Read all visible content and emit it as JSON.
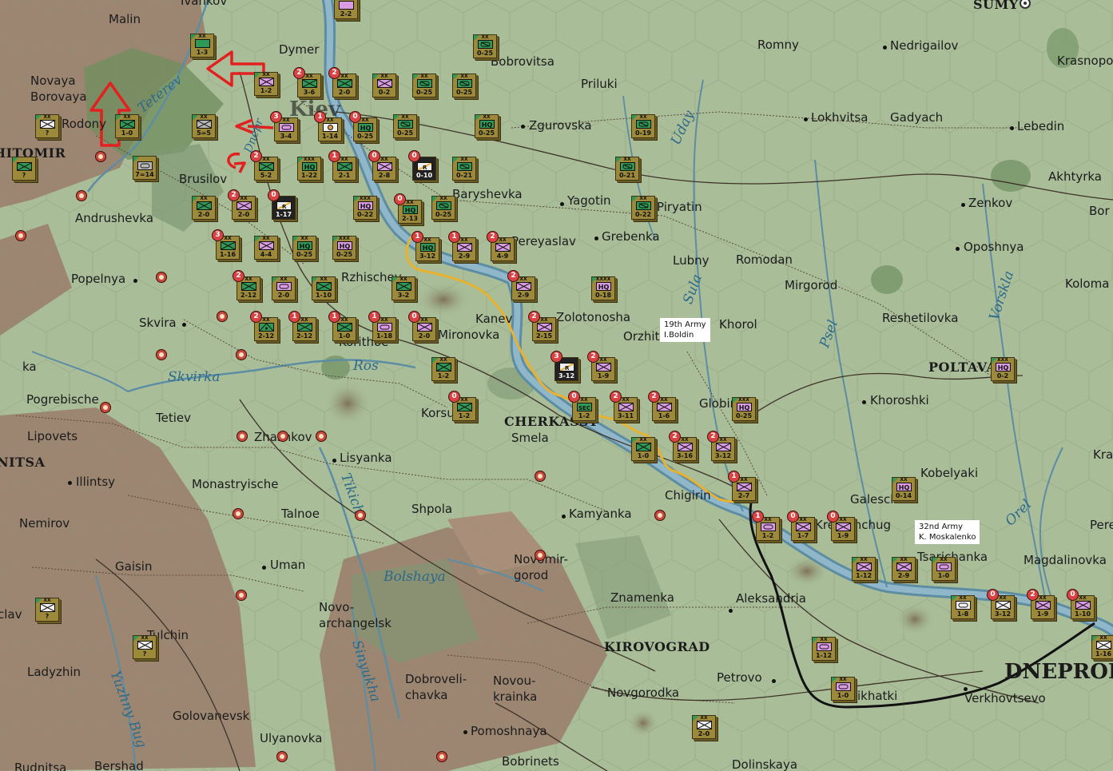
{
  "map": {
    "towns": [
      {
        "id": "ivankov",
        "text": "Ivankov"
      },
      {
        "id": "malin",
        "text": "Malin"
      },
      {
        "id": "dymer",
        "text": "Dymer"
      },
      {
        "id": "bobrovitsa",
        "text": "Bobrovitsa"
      },
      {
        "id": "romny",
        "text": "Romny"
      },
      {
        "id": "nedrigailov",
        "text": "Nedrigailov"
      },
      {
        "id": "sumy",
        "text": "SUMY"
      },
      {
        "id": "krasnopol",
        "text": "Krasnopol"
      },
      {
        "id": "novaya_borovaya",
        "text": "Novaya\nBorovaya"
      },
      {
        "id": "rodony",
        "text": "Rodony"
      },
      {
        "id": "zhitomir",
        "text": "HITOMIR"
      },
      {
        "id": "kiev",
        "text": "Kiev"
      },
      {
        "id": "priluki",
        "text": "Priluki"
      },
      {
        "id": "zgurovska",
        "text": "Zgurovska"
      },
      {
        "id": "lokhvitsa",
        "text": "Lokhvitsa"
      },
      {
        "id": "gadyach",
        "text": "Gadyach"
      },
      {
        "id": "lebedin",
        "text": "Lebedin"
      },
      {
        "id": "akhtyrka",
        "text": "Akhtyrka"
      },
      {
        "id": "brusilov",
        "text": "Brusilov"
      },
      {
        "id": "baryshevka",
        "text": "Baryshevka"
      },
      {
        "id": "yagotin",
        "text": "Yagotin"
      },
      {
        "id": "piryatin",
        "text": "Piryatin"
      },
      {
        "id": "zenkov",
        "text": "Zenkov"
      },
      {
        "id": "bor",
        "text": "Bor"
      },
      {
        "id": "andrushevka",
        "text": "Andrushevka"
      },
      {
        "id": "pereyaslav",
        "text": "Pereyaslav"
      },
      {
        "id": "grebenka",
        "text": "Grebenka"
      },
      {
        "id": "lubny",
        "text": "Lubny"
      },
      {
        "id": "romodan",
        "text": "Romodan"
      },
      {
        "id": "oposhnya",
        "text": "Oposhnya"
      },
      {
        "id": "popelnya",
        "text": "Popelnya"
      },
      {
        "id": "rzhischev",
        "text": "Rzhischev"
      },
      {
        "id": "mirgorod",
        "text": "Mirgorod"
      },
      {
        "id": "koloma",
        "text": "Koloma"
      },
      {
        "id": "skvira",
        "text": "Skvira"
      },
      {
        "id": "kanev",
        "text": "Kanev"
      },
      {
        "id": "zolotonosha",
        "text": "Zolotonosha"
      },
      {
        "id": "horol",
        "text": "Khorol"
      },
      {
        "id": "orzhitsa",
        "text": "Orzhitsa"
      },
      {
        "id": "reshetilovka",
        "text": "Reshetilovka"
      },
      {
        "id": "mironovka",
        "text": "Mironovka"
      },
      {
        "id": "korithoe",
        "text": "Korithoe"
      },
      {
        "id": "poltava",
        "text": "POLTAVA"
      },
      {
        "id": "ka",
        "text": "ka"
      },
      {
        "id": "pogrebische",
        "text": "Pogrebische"
      },
      {
        "id": "korsun",
        "text": "Korsun"
      },
      {
        "id": "globino",
        "text": "Globino"
      },
      {
        "id": "khoroshki",
        "text": "Khoroshki"
      },
      {
        "id": "tetiev",
        "text": "Tetiev"
      },
      {
        "id": "cherkassy",
        "text": "CHERKASSY"
      },
      {
        "id": "smela",
        "text": "Smela"
      },
      {
        "id": "zhashkov",
        "text": "Zhashkov"
      },
      {
        "id": "lisyanka",
        "text": "Lisyanka"
      },
      {
        "id": "vinnitsa",
        "text": "NITSA"
      },
      {
        "id": "lets",
        "text": "Lipovets"
      },
      {
        "id": "kobelyaki",
        "text": "Kobelyaki"
      },
      {
        "id": "illintsy",
        "text": "Illintsy"
      },
      {
        "id": "monastryische",
        "text": "Monastryische"
      },
      {
        "id": "chigirin",
        "text": "Chigirin"
      },
      {
        "id": "galeschina",
        "text": "Galeschina"
      },
      {
        "id": "kra",
        "text": "Kra"
      },
      {
        "id": "nemirov",
        "text": "Nemirov"
      },
      {
        "id": "talnoe",
        "text": "Talnoe"
      },
      {
        "id": "shpola",
        "text": "Shpola"
      },
      {
        "id": "kamyanka",
        "text": "Kamyanka"
      },
      {
        "id": "kremenchug",
        "text": "Kremenchug"
      },
      {
        "id": "pere",
        "text": "Pere"
      },
      {
        "id": "gaisin",
        "text": "Gaisin"
      },
      {
        "id": "uman",
        "text": "Uman"
      },
      {
        "id": "novomirgorod",
        "text": "Novomir-\ngorod"
      },
      {
        "id": "magdalinovka",
        "text": "Magdalinovka"
      },
      {
        "id": "tsarichanka",
        "text": "Tsarichanka"
      },
      {
        "id": "bratslav",
        "text": "clav"
      },
      {
        "id": "novoarkhangelsk",
        "text": "Novo-\narchangelsk"
      },
      {
        "id": "znamenka",
        "text": "Znamenka"
      },
      {
        "id": "aleksandria",
        "text": "Aleksandria"
      },
      {
        "id": "kirovograd",
        "text": "KIROVOGRAD"
      },
      {
        "id": "tulchin",
        "text": "Tulchin"
      },
      {
        "id": "ladyzhin",
        "text": "Ladyzhin"
      },
      {
        "id": "dobrovelichkovka",
        "text": "Dobroveli-\nchavka"
      },
      {
        "id": "novoukrainka",
        "text": "Novou-\nkrainka"
      },
      {
        "id": "novgorodka",
        "text": "Novgorodka"
      },
      {
        "id": "petrovo",
        "text": "Petrovo"
      },
      {
        "id": "dnepropetrovsk",
        "text": "DNEPROP"
      },
      {
        "id": "verkhovtsevo",
        "text": "Verkhovtsevo"
      },
      {
        "id": "pyatikhatki",
        "text": "Pyatikhatki"
      },
      {
        "id": "golovanevsk",
        "text": "Golovanevsk"
      },
      {
        "id": "ulyanovka",
        "text": "Ulyanovka"
      },
      {
        "id": "pomoshnaya",
        "text": "Pomoshnaya"
      },
      {
        "id": "bobrinets",
        "text": "Bobrinets"
      },
      {
        "id": "dolinskaya",
        "text": "Dolinskaya"
      },
      {
        "id": "rudnitsa",
        "text": "Rudnitsa"
      },
      {
        "id": "bershad",
        "text": "Bershad"
      }
    ],
    "rivers": [
      {
        "id": "teterev",
        "text": "Teterev"
      },
      {
        "id": "dnepr",
        "text": "Dnepr"
      },
      {
        "id": "uday",
        "text": "Uday"
      },
      {
        "id": "sula",
        "text": "Sula"
      },
      {
        "id": "psel",
        "text": "Psel"
      },
      {
        "id": "vorskla",
        "text": "Vorskla"
      },
      {
        "id": "ros",
        "text": "Ros"
      },
      {
        "id": "skvirka",
        "text": "Skvirka"
      },
      {
        "id": "tikich",
        "text": "Tikich"
      },
      {
        "id": "orel",
        "text": "Orel"
      },
      {
        "id": "bolshaya",
        "text": "Bolshaya"
      },
      {
        "id": "sinyukha",
        "text": "Sinyukha"
      },
      {
        "id": "yuzhny_bug",
        "text": "Yuzhny Bug"
      }
    ],
    "annotations": [
      {
        "id": "army19",
        "line1": "19th Army",
        "line2": "I.Boldin"
      },
      {
        "id": "army32",
        "line1": "32nd Army",
        "line2": "K. Moskalenko"
      }
    ],
    "units": [
      {
        "id": "u01",
        "size": "XX",
        "val": "1-3",
        "color": "g"
      },
      {
        "id": "u02",
        "size": "XX",
        "val": "2-2",
        "color": "p"
      },
      {
        "id": "u03",
        "size": "XX",
        "val": "0-25",
        "color": "g",
        "kind": "recon"
      },
      {
        "id": "u04",
        "size": "XX",
        "val": "1-2",
        "color": "p",
        "badge": "",
        "kind": "inf"
      },
      {
        "id": "u05",
        "size": "XX",
        "val": "3-6",
        "color": "g",
        "badge": "2",
        "kind": "inf"
      },
      {
        "id": "u06",
        "size": "XX",
        "val": "2-0",
        "color": "g",
        "badge": "2",
        "kind": "inf"
      },
      {
        "id": "u07",
        "size": "XX",
        "val": "0-2",
        "color": "p",
        "kind": "inf"
      },
      {
        "id": "u08",
        "size": "XX",
        "val": "0-25",
        "color": "g",
        "kind": "recon"
      },
      {
        "id": "u09",
        "size": "XX",
        "val": "0-25",
        "color": "g",
        "kind": "recon"
      },
      {
        "id": "u10",
        "size": "XX",
        "val": "1-0",
        "color": "g",
        "kind": "inf"
      },
      {
        "id": "u11",
        "size": "XX",
        "val": "5=5",
        "color": "gr",
        "kind": "inf"
      },
      {
        "id": "u12",
        "size": "XX",
        "val": "?",
        "color": "w",
        "kind": "inf"
      },
      {
        "id": "u13",
        "size": "",
        "val": "?",
        "color": "g",
        "kind": "inf"
      },
      {
        "id": "u14",
        "size": "XX",
        "val": "3-4",
        "color": "p",
        "badge": "3",
        "kind": "arm"
      },
      {
        "id": "u15",
        "size": "XX",
        "val": "1-14",
        "color": "w",
        "badge": "1",
        "kind": "mtn"
      },
      {
        "id": "u16",
        "size": "XX",
        "val": "0-25",
        "color": "g",
        "badge": "0",
        "kind": "hq"
      },
      {
        "id": "u17",
        "size": "XX",
        "val": "0-25",
        "color": "g",
        "kind": "recon"
      },
      {
        "id": "u18",
        "size": "XX",
        "val": "0-25",
        "color": "g",
        "kind": "hq"
      },
      {
        "id": "u19",
        "size": "XX",
        "val": "0-19",
        "color": "g",
        "kind": "recon"
      },
      {
        "id": "u20",
        "size": "",
        "val": "7=14",
        "color": "gr",
        "kind": "arm"
      },
      {
        "id": "u21",
        "size": "XX",
        "val": "5-2",
        "color": "g",
        "badge": "2",
        "kind": "inf"
      },
      {
        "id": "u22",
        "size": "XXX",
        "val": "1-22",
        "color": "g",
        "kind": "hq"
      },
      {
        "id": "u23",
        "size": "XX",
        "val": "2-1",
        "color": "g",
        "badge": "1",
        "kind": "inf"
      },
      {
        "id": "u24",
        "size": "XX",
        "val": "2-8",
        "color": "p",
        "badge": "0",
        "kind": "inf"
      },
      {
        "id": "u25",
        "size": "",
        "val": "0-10",
        "color": "k",
        "badge": "0",
        "kind": "rail"
      },
      {
        "id": "u26",
        "size": "XX",
        "val": "0-21",
        "color": "g",
        "kind": "recon"
      },
      {
        "id": "u27",
        "size": "XX",
        "val": "0-21",
        "color": "g",
        "kind": "recon"
      },
      {
        "id": "u28",
        "size": "XX",
        "val": "2-0",
        "color": "g",
        "kind": "inf"
      },
      {
        "id": "u29",
        "size": "XX",
        "val": "2-0",
        "color": "p",
        "badge": "2",
        "kind": "inf"
      },
      {
        "id": "u30",
        "size": "",
        "val": "1-17",
        "color": "k",
        "badge": "0",
        "kind": "rail"
      },
      {
        "id": "u31",
        "size": "XXX",
        "val": "0-22",
        "color": "p",
        "kind": "hq"
      },
      {
        "id": "u32",
        "size": "XX",
        "val": "2-13",
        "color": "g",
        "badge": "0",
        "kind": "hq"
      },
      {
        "id": "u33",
        "size": "XX",
        "val": "0-25",
        "color": "g",
        "kind": "recon"
      },
      {
        "id": "u34",
        "size": "XX",
        "val": "0-22",
        "color": "g",
        "kind": "recon"
      },
      {
        "id": "u35",
        "size": "XX",
        "val": "1-16",
        "color": "g",
        "badge": "3",
        "kind": "inf"
      },
      {
        "id": "u36",
        "size": "XX",
        "val": "4-4",
        "color": "p",
        "kind": "inf"
      },
      {
        "id": "u37",
        "size": "XX",
        "val": "0-25",
        "color": "g",
        "kind": "hq"
      },
      {
        "id": "u38",
        "size": "XXX",
        "val": "0-25",
        "color": "p",
        "kind": "hq"
      },
      {
        "id": "u39",
        "size": "XX",
        "val": "3-12",
        "color": "g",
        "badge": "1",
        "kind": "hq"
      },
      {
        "id": "u40",
        "size": "XX",
        "val": "2-9",
        "color": "p",
        "badge": "1",
        "kind": "inf"
      },
      {
        "id": "u41",
        "size": "XX",
        "val": "4-9",
        "color": "p",
        "badge": "2",
        "kind": "inf"
      },
      {
        "id": "u42",
        "size": "XX",
        "val": "2-12",
        "color": "g",
        "badge": "2",
        "kind": "inf"
      },
      {
        "id": "u43",
        "size": "XX",
        "val": "2-0",
        "color": "p",
        "kind": "arm"
      },
      {
        "id": "u44",
        "size": "XX",
        "val": "1-10",
        "color": "g",
        "kind": "inf"
      },
      {
        "id": "u45",
        "size": "XX",
        "val": "3-2",
        "color": "g",
        "kind": "inf"
      },
      {
        "id": "u46",
        "size": "XX",
        "val": "2-9",
        "color": "p",
        "badge": "2",
        "kind": "inf"
      },
      {
        "id": "u47",
        "size": "XXXX",
        "val": "0-18",
        "color": "p",
        "kind": "hq"
      },
      {
        "id": "u48",
        "size": "XX",
        "val": "2-12",
        "color": "g",
        "badge": "2",
        "kind": "arty"
      },
      {
        "id": "u49",
        "size": "XX",
        "val": "2-12",
        "color": "g",
        "badge": "1",
        "kind": "inf"
      },
      {
        "id": "u50",
        "size": "XX",
        "val": "1-0",
        "color": "g",
        "badge": "1",
        "kind": "inf"
      },
      {
        "id": "u51",
        "size": "XX",
        "val": "1-18",
        "color": "p",
        "badge": "1",
        "kind": "arm"
      },
      {
        "id": "u52",
        "size": "XX",
        "val": "2-0",
        "color": "p",
        "badge": "0",
        "kind": "inf"
      },
      {
        "id": "u53",
        "size": "XX",
        "val": "2-15",
        "color": "p",
        "badge": "2",
        "kind": "inf"
      },
      {
        "id": "u54",
        "size": "XX",
        "val": "1-2",
        "color": "g",
        "kind": "inf"
      },
      {
        "id": "u55",
        "size": "",
        "val": "3-12",
        "color": "k",
        "badge": "3",
        "kind": "rail"
      },
      {
        "id": "u56",
        "size": "XX",
        "val": "1-9",
        "color": "p",
        "badge": "2",
        "kind": "inf"
      },
      {
        "id": "u57",
        "size": "XX",
        "val": "1-2",
        "color": "g",
        "badge": "0",
        "kind": "inf"
      },
      {
        "id": "u58",
        "size": "XX",
        "val": "1-2",
        "color": "g",
        "badge": "0",
        "kind": "sec"
      },
      {
        "id": "u59",
        "size": "XX",
        "val": "3-11",
        "color": "p",
        "badge": "2",
        "kind": "inf"
      },
      {
        "id": "u60",
        "size": "XX",
        "val": "1-6",
        "color": "p",
        "badge": "2",
        "kind": "inf"
      },
      {
        "id": "u61",
        "size": "XXX",
        "val": "0-25",
        "color": "p",
        "kind": "hq"
      },
      {
        "id": "u62",
        "size": "XX",
        "val": "1-0",
        "color": "g",
        "kind": "inf"
      },
      {
        "id": "u63",
        "size": "XX",
        "val": "3-16",
        "color": "p",
        "badge": "2",
        "kind": "inf"
      },
      {
        "id": "u64",
        "size": "XX",
        "val": "3-12",
        "color": "p",
        "badge": "2",
        "kind": "inf"
      },
      {
        "id": "u65",
        "size": "XX",
        "val": "2-7",
        "color": "p",
        "badge": "1",
        "kind": "inf"
      },
      {
        "id": "u66",
        "size": "XX",
        "val": "0-14",
        "color": "p",
        "kind": "hq"
      },
      {
        "id": "u67",
        "size": "XX",
        "val": "1-2",
        "color": "p",
        "badge": "1",
        "kind": "arm"
      },
      {
        "id": "u68",
        "size": "XX",
        "val": "1-7",
        "color": "p",
        "badge": "0",
        "kind": "inf"
      },
      {
        "id": "u69",
        "size": "XX",
        "val": "1-9",
        "color": "p",
        "badge": "0",
        "kind": "inf"
      },
      {
        "id": "u70",
        "size": "XX",
        "val": "1-12",
        "color": "p",
        "kind": "inf"
      },
      {
        "id": "u71",
        "size": "XX",
        "val": "2-9",
        "color": "p",
        "kind": "inf"
      },
      {
        "id": "u72",
        "size": "XX",
        "val": "1-0",
        "color": "p",
        "kind": "arm"
      },
      {
        "id": "u73",
        "size": "XX",
        "val": "1-8",
        "color": "w",
        "kind": "arm"
      },
      {
        "id": "u74",
        "size": "XX",
        "val": "3-12",
        "color": "w",
        "badge": "0",
        "kind": "inf"
      },
      {
        "id": "u75",
        "size": "XX",
        "val": "1-9",
        "color": "p",
        "badge": "2",
        "kind": "inf"
      },
      {
        "id": "u76",
        "size": "XX",
        "val": "1-10",
        "color": "p",
        "badge": "0",
        "kind": "inf"
      },
      {
        "id": "u77",
        "size": "XX",
        "val": "1-12",
        "color": "p",
        "kind": "arm"
      },
      {
        "id": "u78",
        "size": "XX",
        "val": "1-0",
        "color": "p",
        "kind": "arm"
      },
      {
        "id": "u79",
        "size": "XX",
        "val": "2-0",
        "color": "w",
        "kind": "inf"
      },
      {
        "id": "u80",
        "size": "XX",
        "val": "?",
        "color": "w",
        "kind": "inf"
      },
      {
        "id": "u81",
        "size": "XX",
        "val": "?",
        "color": "w",
        "kind": "inf"
      },
      {
        "id": "u82",
        "size": "XX",
        "val": "1-16",
        "color": "w",
        "kind": "inf"
      },
      {
        "id": "u83",
        "size": "XXX",
        "val": "0-2",
        "color": "p",
        "kind": "hq"
      }
    ]
  }
}
